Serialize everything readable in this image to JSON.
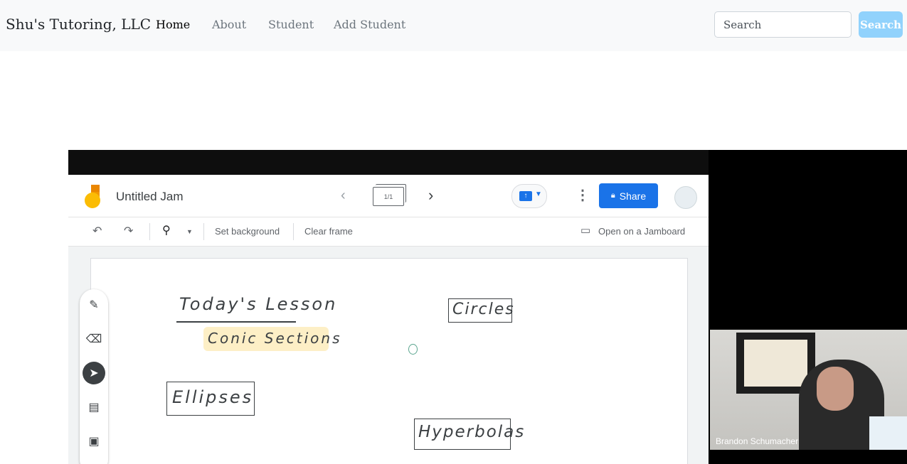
{
  "navbar": {
    "brand": "Shu's Tutoring, LLC",
    "links": [
      {
        "label": "Home",
        "active": true
      },
      {
        "label": "About",
        "active": false
      },
      {
        "label": "Student",
        "active": false
      },
      {
        "label": "Add Student",
        "active": false
      }
    ],
    "search": {
      "placeholder": "Search",
      "button_label": "Search"
    }
  },
  "jamboard": {
    "title": "Untitled Jam",
    "frame_counter": "1/1",
    "share_label": "Share",
    "toolbar": {
      "set_background": "Set background",
      "clear_frame": "Clear frame",
      "open_on_jamboard": "Open on a Jamboard"
    },
    "canvas_notes": {
      "heading": "Today's Lesson",
      "subheading": "Conic Sections",
      "topics": [
        "Circles",
        "Ellipses",
        "Hyperbolas"
      ]
    },
    "icons": [
      "undo-icon",
      "redo-icon",
      "zoom-icon",
      "pen-icon",
      "eraser-icon",
      "select-icon",
      "sticky-note-icon",
      "image-icon",
      "lock-icon",
      "more-vert-icon",
      "present-icon"
    ]
  },
  "video": {
    "participant_name": "Brandon Schumacher"
  },
  "colors": {
    "navbar_bg": "#f8f9fa",
    "search_button_bg": "#91d2fc",
    "share_button_bg": "#1a73e8",
    "highlight": "#fdefc6"
  }
}
